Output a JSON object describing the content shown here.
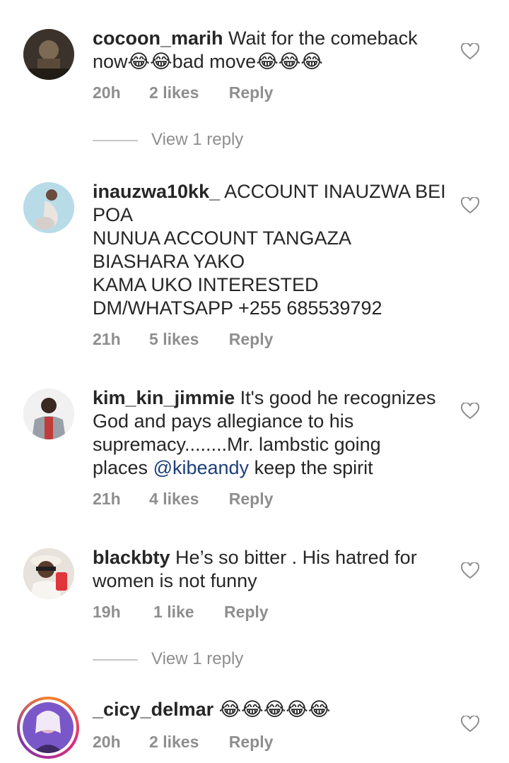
{
  "comments": [
    {
      "username": "cocoon_marih",
      "text": " Wait for the comeback\nnow😂😂bad move😂😂😂",
      "time": "20h",
      "likes": "2 likes",
      "reply": "Reply",
      "view_replies": "View 1 reply"
    },
    {
      "username": "inauzwa10kk_",
      "text": " ACCOUNT INAUZWA BEI\nPOA\nNUNUA ACCOUNT TANGAZA\nBIASHARA YAKO\nKAMA UKO INTERESTED\nDM/WHATSAPP +255 685539792",
      "time": "21h",
      "likes": "5 likes",
      "reply": "Reply"
    },
    {
      "username": "kim_kin_jimmie",
      "text_before": " It's good he recognizes\nGod and pays allegiance to his\nsupremacy........Mr. lambstic going\nplaces ",
      "mention": "@kibeandy",
      "text_after": " keep the spirit",
      "time": "21h",
      "likes": "4 likes",
      "reply": "Reply"
    },
    {
      "username": "blackbty",
      "text": " He’s so bitter . His hatred for\nwomen is not funny",
      "time": "19h",
      "likes": "1 like",
      "reply": "Reply",
      "view_replies": "View 1 reply"
    },
    {
      "username": "_cicy_delmar",
      "text": " 😂😂😂😂😂",
      "time": "20h",
      "likes": "2 likes",
      "reply": "Reply"
    }
  ],
  "icons": {
    "like": "heart-outline-icon"
  }
}
